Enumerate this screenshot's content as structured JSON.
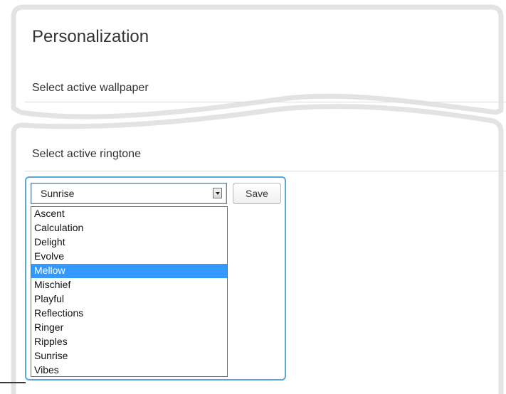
{
  "page": {
    "title": "Personalization"
  },
  "wallpaper": {
    "label": "Select active wallpaper"
  },
  "ringtone": {
    "label": "Select active ringtone",
    "selected_value": "Sunrise",
    "save_label": "Save",
    "options": [
      {
        "label": "Ascent",
        "highlighted": false
      },
      {
        "label": "Calculation",
        "highlighted": false
      },
      {
        "label": "Delight",
        "highlighted": false
      },
      {
        "label": "Evolve",
        "highlighted": false
      },
      {
        "label": "Mellow",
        "highlighted": true
      },
      {
        "label": "Mischief",
        "highlighted": false
      },
      {
        "label": "Playful",
        "highlighted": false
      },
      {
        "label": "Reflections",
        "highlighted": false
      },
      {
        "label": "Ringer",
        "highlighted": false
      },
      {
        "label": "Ripples",
        "highlighted": false
      },
      {
        "label": "Sunrise",
        "highlighted": false
      },
      {
        "label": "Vibes",
        "highlighted": false
      }
    ]
  },
  "colors": {
    "highlight_box": "#5aa7d6",
    "option_highlight": "#3399ff",
    "frame": "#e3e3e3"
  }
}
